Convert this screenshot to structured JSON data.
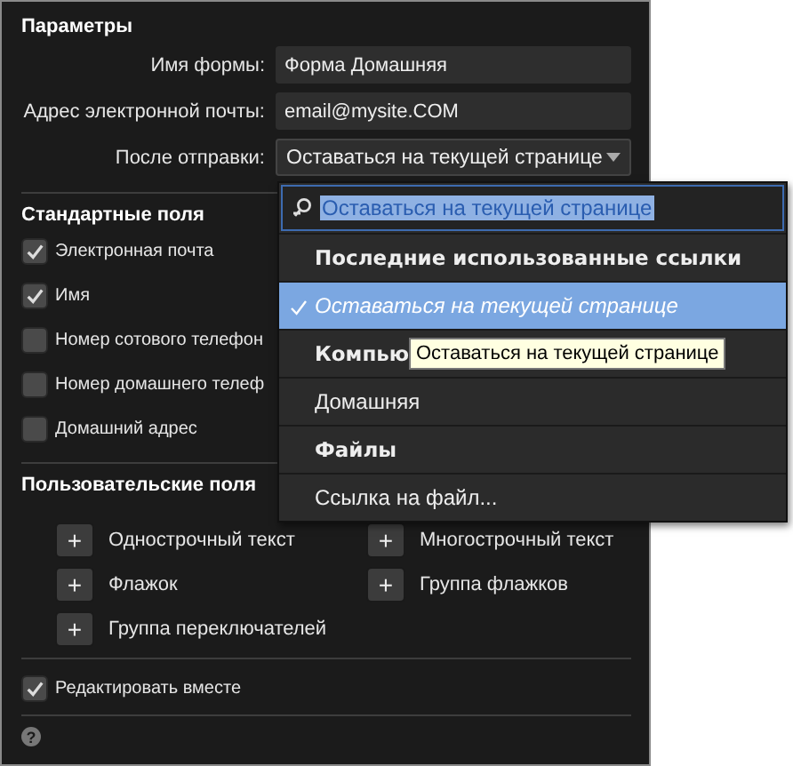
{
  "panel": {
    "title": "Параметры",
    "fields": [
      {
        "kind": "text",
        "label": "Имя формы:",
        "value": "Форма Домашняя"
      },
      {
        "kind": "text",
        "label": "Адрес электронной почты:",
        "value": "email@mysite.COM"
      },
      {
        "kind": "select",
        "label": "После отправки:",
        "value": "Оставаться на текущей странице"
      }
    ],
    "standard_fields": {
      "title": "Стандартные поля",
      "items": [
        {
          "label": "Электронная почта",
          "checked": true
        },
        {
          "label": "Имя",
          "checked": true
        },
        {
          "label": "Номер сотового телефон",
          "checked": false
        },
        {
          "label": "Номер домашнего телеф",
          "checked": false
        },
        {
          "label": "Домашний адрес",
          "checked": false
        }
      ]
    },
    "custom_fields": {
      "title": "Пользовательские поля",
      "buttons": [
        {
          "symbol": "+",
          "label": "Однострочный текст"
        },
        {
          "symbol": "+",
          "label": "Многострочный текст"
        },
        {
          "symbol": "+",
          "label": "Флажок"
        },
        {
          "symbol": "+",
          "label": "Группа флажков"
        },
        {
          "symbol": "+",
          "label": "Группа переключателей"
        }
      ]
    },
    "edit_together": {
      "label": "Редактировать вместе",
      "checked": true
    },
    "help": "?"
  },
  "dropdown": {
    "search": {
      "value": "Оставаться на текущей странице"
    },
    "items": [
      {
        "kind": "header",
        "label": "Последние использованные ссылки"
      },
      {
        "kind": "option",
        "label": "Оставаться на текущей странице",
        "selected": true
      },
      {
        "kind": "header",
        "label": "Компью"
      },
      {
        "kind": "option",
        "label": "Домашняя",
        "selected": false
      },
      {
        "kind": "header",
        "label": "Файлы"
      },
      {
        "kind": "option",
        "label": "Ссылка на файл...",
        "selected": false
      }
    ]
  },
  "tooltip": {
    "text": "Оставаться на текущей странице"
  }
}
